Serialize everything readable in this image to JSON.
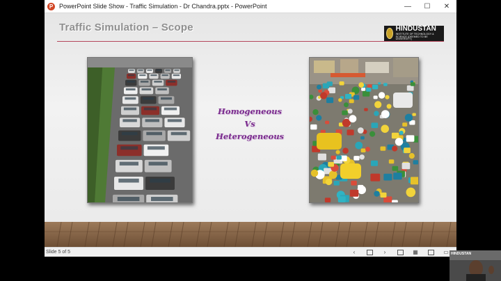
{
  "window": {
    "title": "PowerPoint Slide Show  -  Traffic Simulation - Dr Chandra.pptx - PowerPoint",
    "controls": {
      "minimize": "—",
      "maximize": "☐",
      "close": "✕"
    }
  },
  "slide": {
    "title": "Traffic Simulation – Scope",
    "logo": {
      "name": "HINDUSTAN",
      "subtitle": "INSTITUTE OF TECHNOLOGY & SCIENCE (DEEMED TO BE UNIVERSITY)"
    },
    "center_lines": [
      "Homogeneous",
      "Vs",
      "Heterogeneous"
    ],
    "accent_color": "#b5475b",
    "text_color": "#7b2c8e"
  },
  "statusbar": {
    "slide_indicator": "Slide 5 of 5",
    "icons": [
      "prev-icon",
      "notes-icon",
      "next-icon",
      "normal-view-icon",
      "slide-sorter-icon",
      "reading-view-icon",
      "slideshow-icon"
    ]
  },
  "webcam": {
    "overlay_text": "HINDUSTAN"
  }
}
